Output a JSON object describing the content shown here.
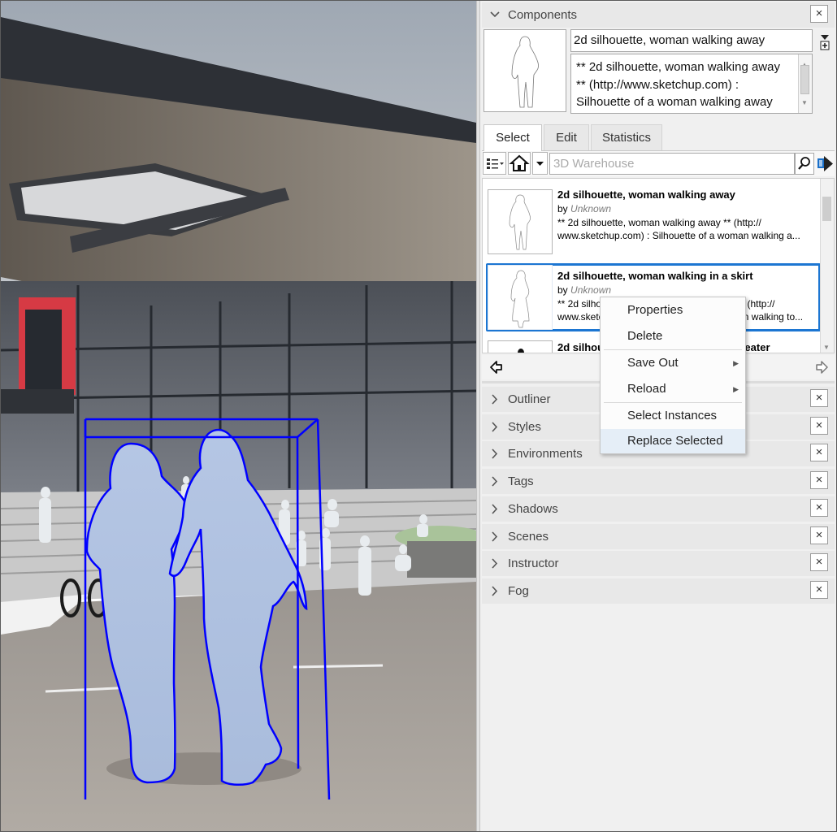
{
  "components_panel": {
    "title": "Components",
    "close": "×",
    "name_value": "2d silhouette, woman walking away",
    "description": [
      "** 2d silhouette, woman walking away",
      "** (http://www.sketchup.com) :",
      "Silhouette of a woman walking away"
    ],
    "tabs": [
      "Select",
      "Edit",
      "Statistics"
    ],
    "search_placeholder": "3D Warehouse",
    "results": [
      {
        "title": "2d silhouette, woman walking away",
        "by_prefix": "by",
        "author": "Unknown",
        "desc_line1": "** 2d silhouette, woman walking away ** (http://",
        "desc_line2": "www.sketchup.com) :  Silhouette of a woman walking a..."
      },
      {
        "title": "2d silhouette, woman walking in a skirt",
        "by_prefix": "by",
        "author": "Unknown",
        "desc_line1": "** 2d silhouette, woman walking in a skirt ** (http://",
        "desc_line2": "www.sketchup.com) :  Silhouette of a woman walking to..."
      },
      {
        "title": "2d silhouette, woman walking in a sweater"
      }
    ]
  },
  "context_menu": {
    "items": [
      "Properties",
      "Delete",
      "Save Out",
      "Reload",
      "Select Instances",
      "Replace Selected"
    ],
    "highlighted": "Replace Selected"
  },
  "collapsed_panels": [
    "Outliner",
    "Styles",
    "Environments",
    "Tags",
    "Shadows",
    "Scenes",
    "Instructor",
    "Fog"
  ],
  "colors": {
    "selection": "#1c76d2",
    "model_selection": "#0000ff",
    "silhouette_fill": "#b4c7e7"
  },
  "icons": {
    "collapse": "chevron-down-icon",
    "expand": "chevron-right-icon",
    "close": "close-icon",
    "search": "magnifier-icon",
    "home": "home-icon",
    "back": "arrow-left-icon",
    "forward": "arrow-right-icon"
  }
}
